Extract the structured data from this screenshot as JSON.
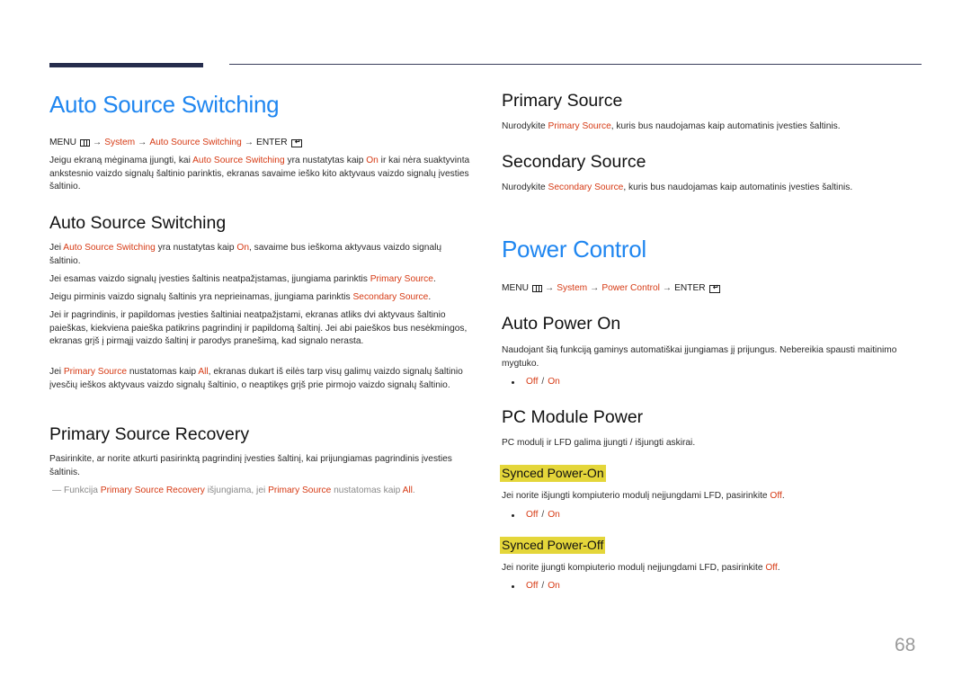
{
  "left": {
    "title": "Auto Source Switching",
    "menu_path": {
      "menu": "MENU",
      "arrow": "→",
      "system": "System",
      "item": "Auto Source Switching",
      "enter": "ENTER"
    },
    "intro": {
      "t1": "Jeigu ekraną mėginama įjungti, kai ",
      "h1": "Auto Source Switching",
      "t2": " yra nustatytas kaip ",
      "h2": "On",
      "t3": " ir kai nėra suaktyvinta ankstesnio vaizdo signalų šaltinio parinktis, ekranas savaime ieško kito aktyvaus vaizdo signalų įvesties šaltinio."
    },
    "section_ass": {
      "heading": "Auto Source Switching",
      "p1": {
        "t1": "Jei ",
        "h1": "Auto Source Switching",
        "t2": " yra nustatytas kaip ",
        "h2": "On",
        "t3": ", savaime bus ieškoma aktyvaus vaizdo signalų šaltinio."
      },
      "p2": {
        "t1": "Jei esamas vaizdo signalų įvesties šaltinis neatpažįstamas, įjungiama parinktis ",
        "h1": "Primary Source",
        "t2": "."
      },
      "p3": {
        "t1": "Jeigu pirminis vaizdo signalų šaltinis yra neprieinamas, įjungiama parinktis ",
        "h1": "Secondary Source",
        "t2": "."
      },
      "p4": "Jei ir pagrindinis, ir papildomas įvesties šaltiniai neatpažįstami, ekranas atliks dvi aktyvaus šaltinio paieškas, kiekviena paieška patikrins pagrindinį ir papildomą šaltinį. Jei abi paieškos bus nesėkmingos, ekranas grįš į pirmąjį vaizdo šaltinį ir parodys pranešimą, kad signalo nerasta.",
      "p5": {
        "t1": "Jei ",
        "h1": "Primary Source",
        "t2": " nustatomas kaip ",
        "h2": "All",
        "t3": ", ekranas dukart iš eilės tarp visų galimų vaizdo signalų šaltinio įvesčių ieškos aktyvaus vaizdo signalų šaltinio, o neaptikęs grįš prie pirmojo vaizdo signalų šaltinio."
      }
    },
    "section_psr": {
      "heading": "Primary Source Recovery",
      "p1": "Pasirinkite, ar norite atkurti pasirinktą pagrindinį įvesties šaltinį, kai prijungiamas pagrindinis įvesties šaltinis.",
      "note": {
        "dash": "―",
        "t1": " Funkcija ",
        "h1": "Primary Source Recovery",
        "t2": " išjungiama, jei ",
        "h2": "Primary Source",
        "t3": " nustatomas kaip ",
        "h3": "All",
        "t4": "."
      }
    }
  },
  "right": {
    "primary_source": {
      "heading": "Primary Source",
      "p": {
        "t1": "Nurodykite ",
        "h1": "Primary Source",
        "t2": ", kuris bus naudojamas kaip automatinis įvesties šaltinis."
      }
    },
    "secondary_source": {
      "heading": "Secondary Source",
      "p": {
        "t1": "Nurodykite ",
        "h1": "Secondary Source",
        "t2": ", kuris bus naudojamas kaip automatinis įvesties šaltinis."
      }
    },
    "power_control": {
      "title": "Power Control",
      "menu_path": {
        "menu": "MENU",
        "arrow": "→",
        "system": "System",
        "item": "Power Control",
        "enter": "ENTER"
      }
    },
    "auto_power_on": {
      "heading": "Auto Power On",
      "p": "Naudojant šią funkciją gaminys automatiškai įjungiamas jį prijungus. Nebereikia spausti maitinimo mygtuko.",
      "options": {
        "off": "Off",
        "sep": "/",
        "on": "On"
      }
    },
    "pc_module_power": {
      "heading": "PC Module Power",
      "p": "PC modulį ir LFD galima įjungti / išjungti askirai.",
      "synced_on": {
        "heading": "Synced Power-On",
        "p": {
          "t1": "Jei norite išjungti kompiuterio modulį neįjungdami LFD, pasirinkite ",
          "h1": "Off",
          "t2": "."
        },
        "options": {
          "off": "Off",
          "sep": "/",
          "on": "On"
        }
      },
      "synced_off": {
        "heading": "Synced Power-Off",
        "p": {
          "t1": "Jei norite įjungti kompiuterio modulį neįjungdami LFD, pasirinkite ",
          "h1": "Off",
          "t2": "."
        },
        "options": {
          "off": "Off",
          "sep": "/",
          "on": "On"
        }
      }
    }
  },
  "page_number": "68",
  "colors": {
    "title_blue": "#1f86f0",
    "highlight_red": "#d63a14",
    "yellow_highlight": "#e4d63a",
    "rule_navy": "#262d4d"
  }
}
